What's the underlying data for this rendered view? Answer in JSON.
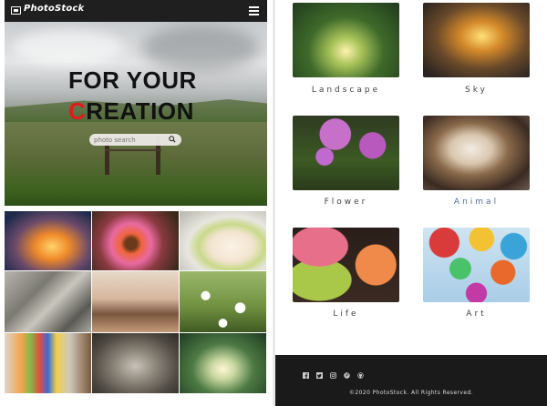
{
  "navbar": {
    "logo_text": "PhotoStock",
    "logo_icon": "photo-icon",
    "menu_icon": "hamburger-menu-icon"
  },
  "hero": {
    "headline_line1": "FOR YOUR",
    "headline_line2_first": "C",
    "headline_line2_rest": "REATION",
    "accent_color": "#e11b1b",
    "search_placeholder": "photo search",
    "search_icon": "search-icon"
  },
  "gallery": {
    "photos": [
      "sunset-tree",
      "orange-flower",
      "food-plate",
      "palm-leaves",
      "woman-beach",
      "daisies",
      "colorful-pencils",
      "cat-tree",
      "forest-sunlight"
    ]
  },
  "categories": [
    {
      "label": "Landscape"
    },
    {
      "label": "Sky"
    },
    {
      "label": "Flower"
    },
    {
      "label": "Animal"
    },
    {
      "label": "Life"
    },
    {
      "label": "Art"
    }
  ],
  "footer": {
    "social": [
      "facebook-icon",
      "twitter-icon",
      "instagram-icon",
      "pinterest-icon",
      "github-icon"
    ],
    "copyright": "©2020 PhotoStock. All Rights Reserved."
  }
}
